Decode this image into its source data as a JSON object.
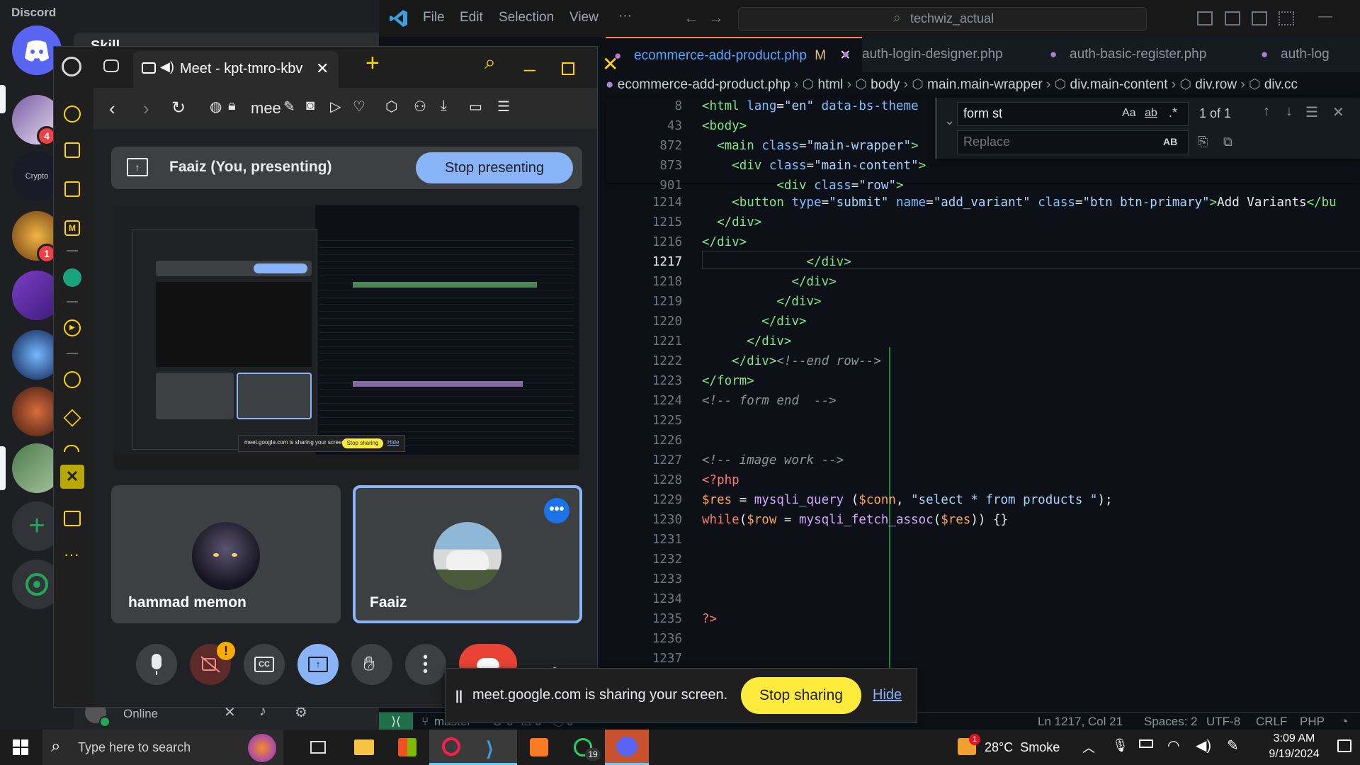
{
  "discord": {
    "title": "Discord",
    "channel_header": "Skill",
    "user_status": "Online",
    "server_labels": [
      "Crypto"
    ],
    "badges": [
      "4",
      "1"
    ]
  },
  "vscode": {
    "menu": [
      "File",
      "Edit",
      "Selection",
      "View",
      "···"
    ],
    "search": "techwiz_actual",
    "tabs": [
      {
        "label": "ecommerce-add-product.php",
        "status": "M"
      },
      {
        "label": "auth-login-designer.php"
      },
      {
        "label": "auth-basic-register.php"
      },
      {
        "label": "auth-log"
      }
    ],
    "breadcrumbs": [
      "ecommerce-add-product.php",
      "html",
      "body",
      "main.main-wrapper",
      "div.main-content",
      "div.row",
      "div.cc"
    ],
    "find": {
      "query": "form st",
      "result": "1 of 1",
      "replace_placeholder": "Replace",
      "opt_case": "Aa",
      "opt_word": "ab",
      "opt_regex": ".*",
      "opt_preserve": "AB"
    },
    "status": {
      "branch": "master",
      "errors": "0",
      "warnings": "0",
      "ports": "0",
      "position": "Ln 1217, Col 21",
      "spaces": "Spaces: 2",
      "encoding": "UTF-8",
      "eol": "CRLF",
      "lang": "PHP"
    },
    "lines": [
      {
        "n": "8",
        "html": "<span class='tag'>&lt;html</span> <span class='attr'>lang</span>=<span class='str'>\"en\"</span> <span class='attr'>data-bs-theme</span>"
      },
      {
        "n": "43",
        "html": "<span class='tag'>&lt;body&gt;</span>"
      },
      {
        "n": "872",
        "html": "  <span class='tag'>&lt;main</span> <span class='attr'>class</span>=<span class='str'>\"main-wrapper\"</span><span class='tag'>&gt;</span>"
      },
      {
        "n": "873",
        "html": "    <span class='tag'>&lt;div</span> <span class='attr'>class</span>=<span class='str'>\"main-content\"</span><span class='tag'>&gt;</span>"
      },
      {
        "n": "901",
        "html": "          <span class='tag'>&lt;div</span> <span class='attr'>class</span>=<span class='str'>\"row\"</span><span class='tag'>&gt;</span>"
      },
      {
        "n": "1214",
        "html": "    <span class='tag'>&lt;button</span> <span class='attr'>type</span>=<span class='str'>\"submit\"</span> <span class='attr'>name</span>=<span class='str'>\"add_variant\"</span> <span class='attr'>class</span>=<span class='str'>\"btn btn-primary\"</span><span class='tag'>&gt;</span>Add Variants<span class='tag'>&lt;/bu</span>"
      },
      {
        "n": "1215",
        "html": "  <span class='tag'>&lt;/div&gt;</span>"
      },
      {
        "n": "1216",
        "html": "<span class='tag'>&lt;/div&gt;</span>"
      },
      {
        "n": "1217",
        "html": "              <span class='tag'>&lt;/div&gt;</span>"
      },
      {
        "n": "1218",
        "html": "            <span class='tag'>&lt;/div&gt;</span>"
      },
      {
        "n": "1219",
        "html": "          <span class='tag'>&lt;/div&gt;</span>"
      },
      {
        "n": "1220",
        "html": "        <span class='tag'>&lt;/div&gt;</span>"
      },
      {
        "n": "1221",
        "html": "      <span class='tag'>&lt;/div&gt;</span>"
      },
      {
        "n": "1222",
        "html": "    <span class='tag'>&lt;/div&gt;</span><span class='cmt'>&lt;!--end row--&gt;</span>"
      },
      {
        "n": "1223",
        "html": "<span class='tag'>&lt;/form&gt;</span>"
      },
      {
        "n": "1224",
        "html": "<span class='cmt'>&lt;!-- form end  --&gt;</span>"
      },
      {
        "n": "1225",
        "html": ""
      },
      {
        "n": "1226",
        "html": ""
      },
      {
        "n": "1227",
        "html": "<span class='cmt'>&lt;!-- image work --&gt;</span>"
      },
      {
        "n": "1228",
        "html": "<span class='php'>&lt;?php</span>"
      },
      {
        "n": "1229",
        "html": "<span class='var'>$res</span> = <span class='fn'>mysqli_query</span> (<span class='var'>$conn</span>, <span class='str'>\"select * from products \"</span>);"
      },
      {
        "n": "1230",
        "html": "<span class='kw'>while</span>(<span class='var'>$row</span> = <span class='fn'>mysqli_fetch_assoc</span>(<span class='var'>$res</span>)) {}"
      },
      {
        "n": "1231",
        "html": ""
      },
      {
        "n": "1232",
        "html": ""
      },
      {
        "n": "1233",
        "html": ""
      },
      {
        "n": "1234",
        "html": ""
      },
      {
        "n": "1235",
        "html": "<span class='php'>?&gt;</span>"
      },
      {
        "n": "1236",
        "html": ""
      },
      {
        "n": "1237",
        "html": ""
      }
    ]
  },
  "meet": {
    "tab_title": "Meet - kpt-tmro-kbv",
    "address": "mee",
    "presenting_label": "Faaiz (You, presenting)",
    "stop_presenting": "Stop presenting",
    "participants": [
      {
        "name": "hammad memon"
      },
      {
        "name": "Faaiz"
      }
    ],
    "camera_alert": "!",
    "preview_small_sharing": "meet.google.com is sharing your screen.",
    "preview_small_stop": "Stop sharing",
    "preview_small_hide": "Hide"
  },
  "share_bar": {
    "message": "meet.google.com is sharing your screen.",
    "stop": "Stop sharing",
    "hide": "Hide"
  },
  "taskbar": {
    "search_placeholder": "Type here to search",
    "weather": "28°C  Smoke",
    "weather_badge": "1",
    "time": "3:09 AM",
    "date": "9/19/2024",
    "whatsapp_badge": "19"
  },
  "colors": {
    "meet_blue": "#8ab4f8",
    "hangup": "#ea4335",
    "share_yellow": "#ffeb3b",
    "vscode_accent": "#f78166",
    "discord_red": "#f23f43"
  }
}
